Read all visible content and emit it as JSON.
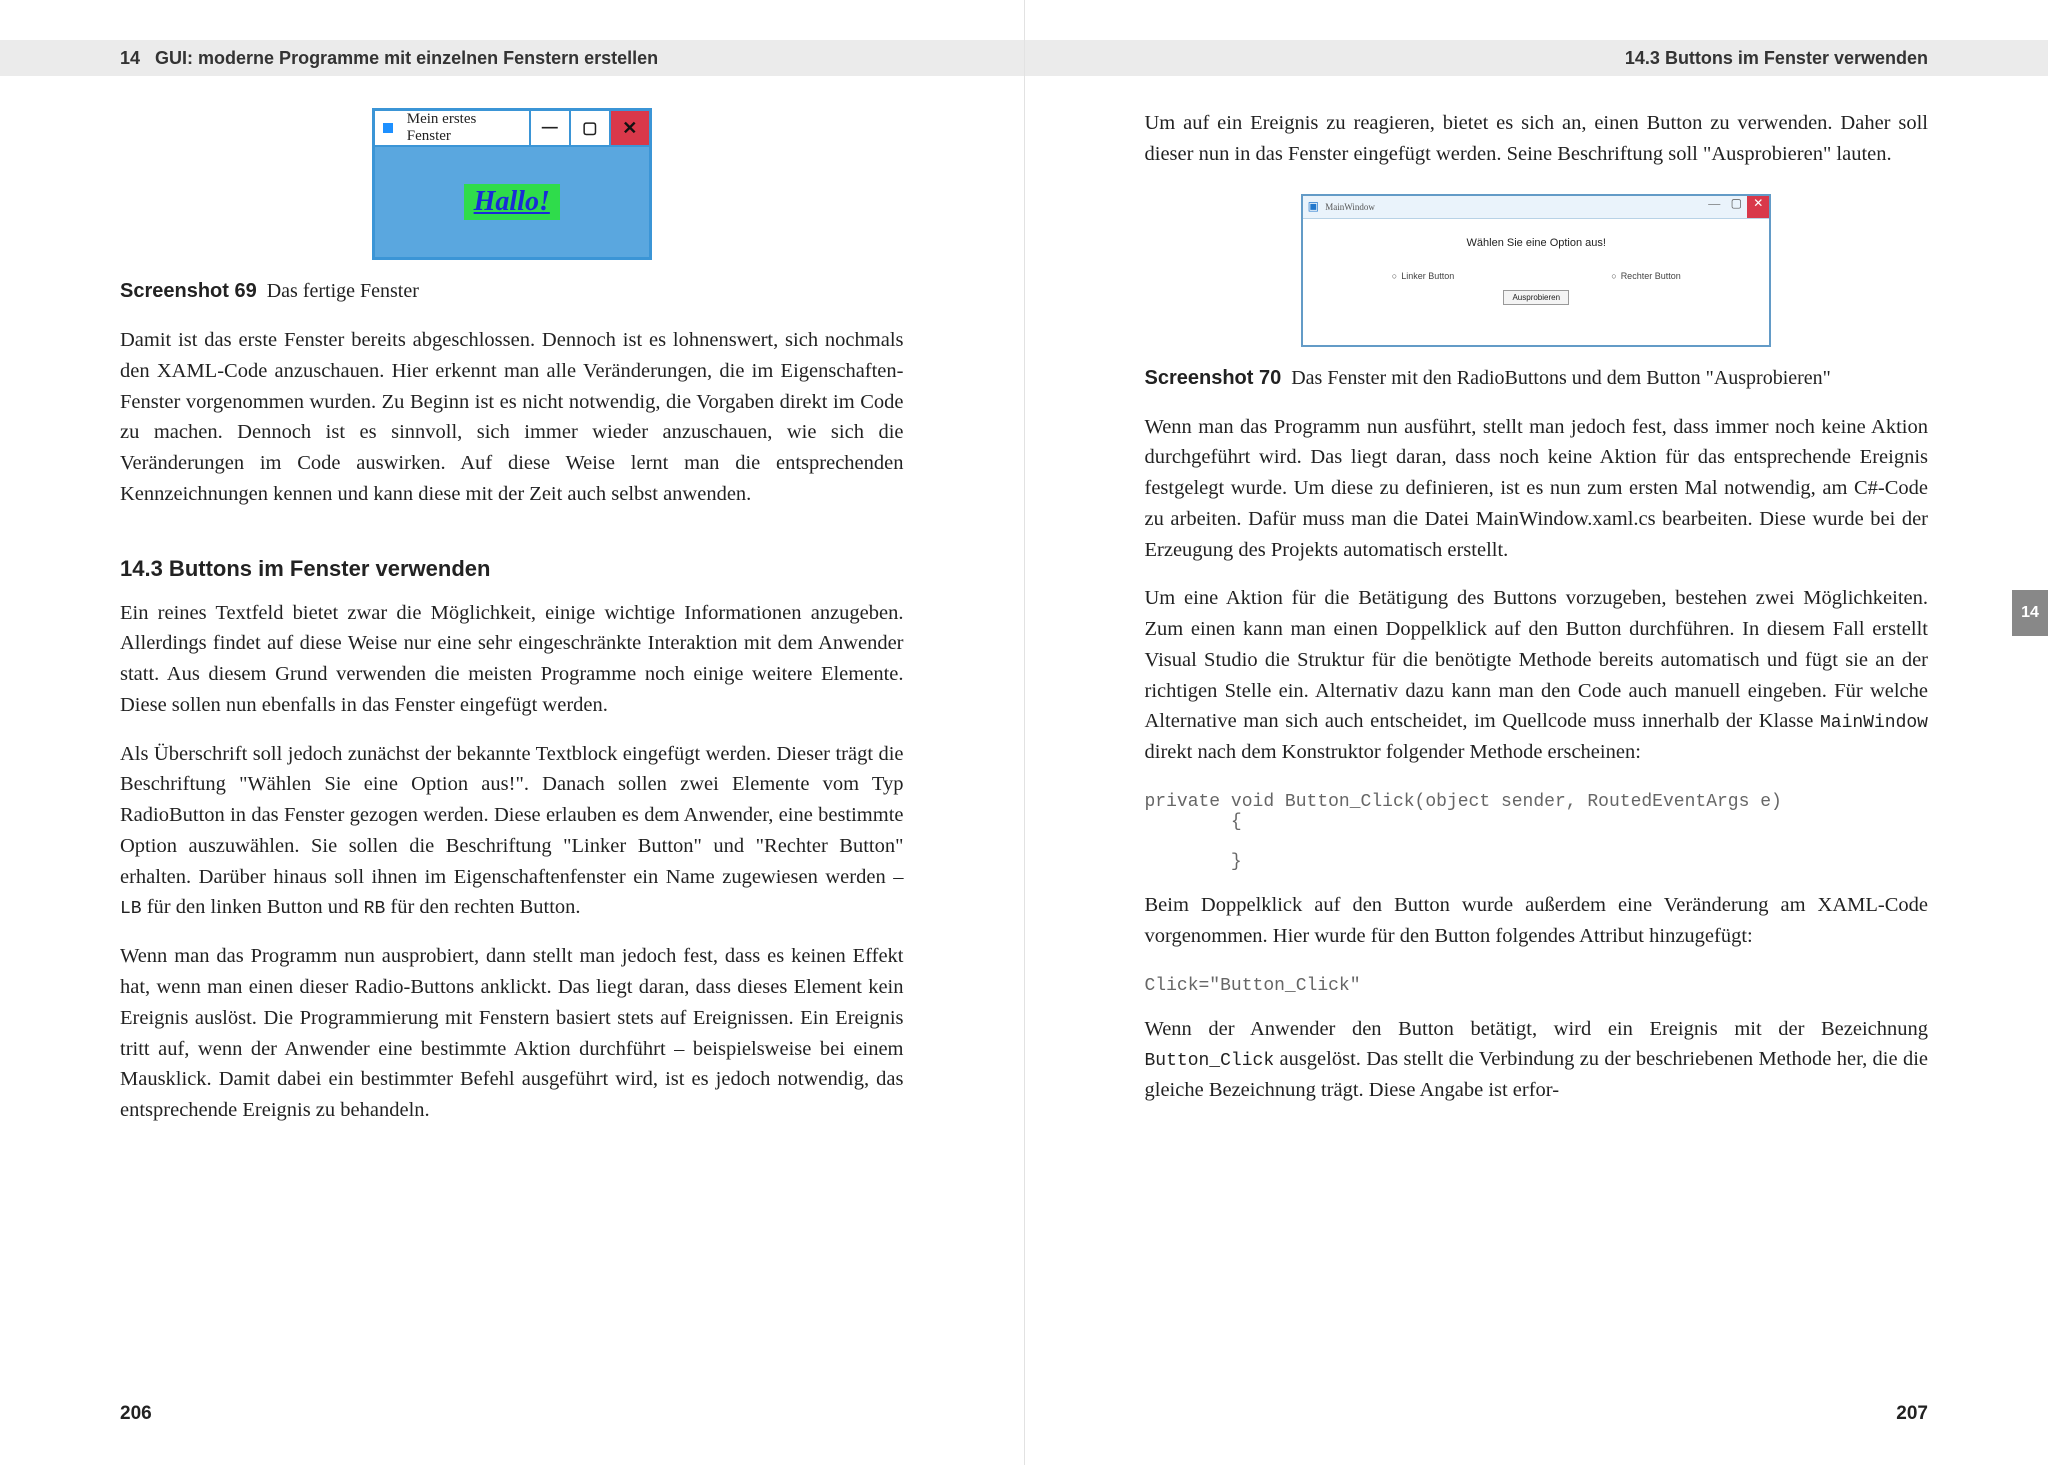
{
  "left": {
    "runhead_num": "14",
    "runhead_title": "GUI: moderne Programme mit einzelnen Fenstern erstellen",
    "fig69": {
      "title": "Mein erstes Fenster",
      "label": "Hallo!"
    },
    "caption69_label": "Screenshot 69",
    "caption69_text": "Das fertige Fenster",
    "para1": "Damit ist das erste Fenster bereits abgeschlossen. Dennoch ist es lohnenswert, sich nochmals den XAML-Code anzuschauen. Hier erkennt man alle Veränderungen, die im Eigenschaften-Fenster vorgenommen wurden. Zu Beginn ist es nicht notwendig, die Vorgaben direkt im Code zu machen. Dennoch ist es sinnvoll, sich immer wieder anzuschauen, wie sich die Veränderungen im Code auswirken. Auf diese Weise lernt man die entsprechenden Kennzeichnungen kennen und kann diese mit der Zeit auch selbst anwenden.",
    "section": "14.3   Buttons im Fenster verwenden",
    "para2": "Ein reines Textfeld bietet zwar die Möglichkeit, einige wichtige Informationen anzugeben. Allerdings findet auf diese Weise nur eine sehr eingeschränkte Interaktion mit dem Anwender statt. Aus diesem Grund verwenden die meisten Programme noch einige weitere Elemente. Diese sollen nun ebenfalls in das Fenster eingefügt werden.",
    "para3a": "Als Überschrift soll jedoch zunächst der bekannte Textblock eingefügt werden. Dieser trägt die Beschriftung \"Wählen Sie eine Option aus!\". Danach sollen zwei Elemente vom Typ RadioButton in das Fenster gezogen werden. Diese erlauben es dem Anwender, eine bestimmte Option auszuwählen. Sie sollen die Beschriftung \"Linker Button\" und \"Rechter Button\" erhalten. Darüber hinaus soll ihnen im Eigenschaftenfenster ein Name zugewiesen werden – ",
    "para3_code1": "LB",
    "para3b": " für den linken Button und ",
    "para3_code2": "RB",
    "para3c": " für den rechten Button.",
    "para4": "Wenn man das Programm nun ausprobiert, dann stellt man jedoch fest, dass es keinen Effekt hat, wenn man einen dieser Radio-Buttons anklickt. Das liegt daran, dass dieses Element kein Ereignis auslöst. Die Programmierung mit Fenstern basiert stets auf Ereignissen. Ein Ereignis tritt auf, wenn der Anwender eine bestimmte Aktion durchführt – beispielsweise bei einem Mausklick. Damit dabei ein bestimmter Befehl ausgeführt wird, ist es jedoch notwendig, das entsprechende Ereignis zu behandeln.",
    "folio": "206"
  },
  "right": {
    "runhead": "14.3   Buttons im Fenster verwenden",
    "para1": "Um auf ein Ereignis zu reagieren, bietet es sich an, einen Button zu verwenden. Daher soll dieser nun in das Fenster eingefügt werden. Seine Beschriftung soll \"Ausprobieren\" lauten.",
    "fig70": {
      "title": "MainWindow",
      "heading": "Wählen Sie eine Option aus!",
      "radio_left": "Linker Button",
      "radio_right": "Rechter Button",
      "button": "Ausprobieren"
    },
    "caption70_label": "Screenshot 70",
    "caption70_text": "Das Fenster mit den RadioButtons und dem Button \"Ausprobieren\"",
    "para2": "Wenn man das Programm nun ausführt, stellt man jedoch fest, dass immer noch keine Aktion durchgeführt wird. Das liegt daran, dass noch keine Aktion für das entsprechende Ereignis festgelegt wurde. Um diese zu definieren, ist es nun zum ersten Mal notwendig, am C#-Code zu arbeiten. Dafür muss man die Datei MainWindow.xaml.cs bearbeiten. Diese wurde bei der Erzeugung des Projekts automatisch erstellt.",
    "para3a": "Um eine Aktion für die Betätigung des Buttons vorzugeben, bestehen zwei Möglichkeiten. Zum einen kann man einen Doppelklick auf den Button durchführen. In diesem Fall erstellt Visual Studio die Struktur für die benötigte Methode bereits automatisch und fügt sie an der richtigen Stelle ein. Alternativ dazu kann man den Code auch manuell eingeben. Für welche Alternative man sich auch entscheidet, im Quellcode muss innerhalb der Klasse ",
    "para3_code": "MainWindow",
    "para3b": " direkt nach dem Konstruktor folgender Methode erscheinen:",
    "code1": "private void Button_Click(object sender, RoutedEventArgs e)\n        {\n\n        }",
    "para4": "Beim Doppelklick auf den Button wurde außerdem eine Veränderung am XAML-Code vorgenommen. Hier wurde für den Button folgendes Attribut hinzugefügt:",
    "code2": "Click=\"Button_Click\"",
    "para5a": "Wenn der Anwender den Button betätigt, wird ein Ereignis mit der Bezeichnung ",
    "para5_code": "Button_Click",
    "para5b": " ausgelöst. Das stellt die Verbindung zu der beschriebenen Methode her, die die gleiche Bezeichnung trägt. Diese Angabe ist erfor-",
    "folio": "207",
    "sidetab": "14"
  }
}
